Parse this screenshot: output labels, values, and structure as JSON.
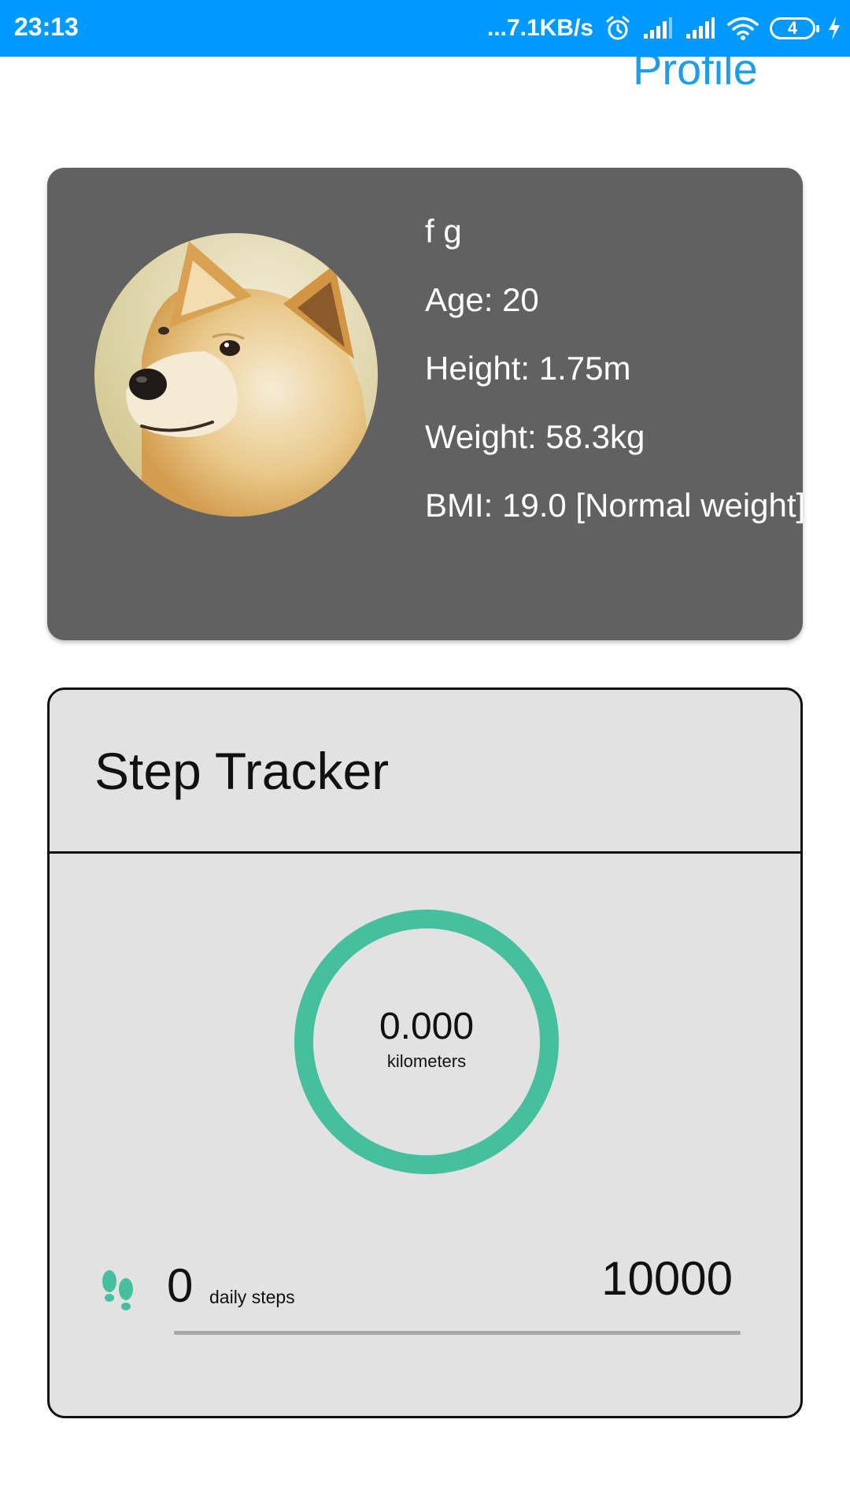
{
  "status_bar": {
    "time": "23:13",
    "network_speed": "...7.1KB/s",
    "battery_level": "4",
    "icons": [
      "alarm-icon",
      "signal-icon",
      "signal-icon",
      "wifi-icon",
      "battery-icon",
      "charging-icon"
    ]
  },
  "header": {
    "title": "Profile"
  },
  "profile": {
    "avatar": "shiba-inu-dog-photo",
    "name": "f g",
    "age": "Age: 20",
    "height": "Height: 1.75m",
    "weight": "Weight: 58.3kg",
    "bmi": "BMI: 19.0 [Normal weight]",
    "card_color": "#616161"
  },
  "step_tracker": {
    "title": "Step Tracker",
    "distance_value": "0.000",
    "distance_unit": "kilometers",
    "steps_icon": "footsteps-icon",
    "daily_steps": "0",
    "daily_steps_label": "daily steps",
    "goal": "10000",
    "progress_fraction": 0,
    "accent_color": "#45bf9d"
  }
}
